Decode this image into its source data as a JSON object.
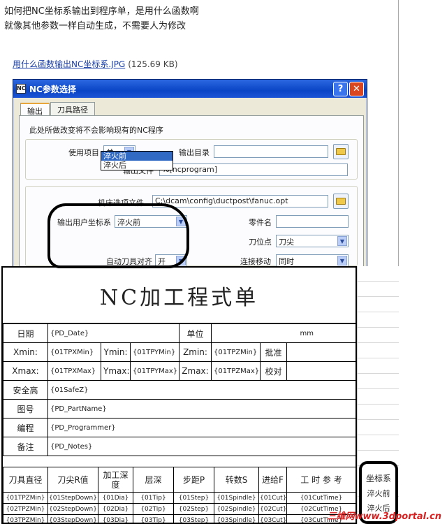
{
  "post": {
    "line1": "如何把NC坐标系输出到程序单，是用什么函数啊",
    "line2": "就像其他参数一样自动生成，不需要人为修改",
    "attachment_name": "用什么函数输出NC坐标系.JPG",
    "attachment_size": "(125.69 KB)"
  },
  "dialog": {
    "title": "NC参数选择",
    "help_btn": "?",
    "close_btn": "✕",
    "tabs": [
      "输出",
      "刀具路径"
    ],
    "note": "此处所做改变将不会影响现有的NC程序",
    "use_item_label": "使用项目",
    "use_item_value": "关",
    "output_dir_label": "输出目录",
    "output_dir_value": "",
    "output_file_label": "输出文件",
    "output_file_value": "%[ncprogram]",
    "machine_file_label": "机床选项文件",
    "machine_file_value": "C:\\dcam\\config\\ductpost\\fanuc.opt",
    "user_coord_label": "输出用户坐标系",
    "user_coord_value": "淬火前",
    "user_coord_options": [
      "淬火前",
      "淬火后"
    ],
    "part_name_label": "零件名",
    "part_name_value": "",
    "tool_point_label": "刀位点",
    "tool_point_value": "刀尖",
    "auto_align_label": "自动刀具对齐",
    "auto_align_value": "开",
    "connect_label": "连接移动",
    "connect_value": "同时"
  },
  "sheet": {
    "title": "NC加工程式单",
    "date_label": "日期",
    "date_value": "{PD_Date}",
    "unit_label": "单位",
    "unit_value": "mm",
    "xmin_label": "Xmin:",
    "xmin_value": "{01TPXMin}",
    "ymin_label": "Ymin:",
    "ymin_value": "{01TPYMin}",
    "zmin_label": "Zmin:",
    "zmin_value": "{01TPZMin}",
    "approve_label": "批准",
    "xmax_label": "Xmax:",
    "xmax_value": "{01TPXMax}",
    "ymax_label": "Ymax:",
    "ymax_value": "{01TPYMax}",
    "zmax_label": "Zmax:",
    "zmax_value": "{01TPZMax}",
    "check_label": "校对",
    "safe_label": "安全高",
    "safe_value": "{01SafeZ}",
    "drawing_label": "图号",
    "drawing_value": "{PD_PartName}",
    "prog_label": "编程",
    "prog_value": "{PD_Programmer}",
    "notes_label": "备注",
    "notes_value": "{PD_Notes}",
    "tool_headers": [
      "刀具直径",
      "刀尖R值",
      "加工深度",
      "层深",
      "步距P",
      "转数S",
      "进给F",
      "工 时 参 考"
    ],
    "tool_rows": [
      [
        "{01TPZMin}",
        "{01StepDown}",
        "{01Dia}",
        "{01Tip}",
        "{01Step}",
        "{01Spindle}",
        "{01Cut}",
        "{01CutTime}"
      ],
      [
        "{02TPZMin}",
        "{02StepDown}",
        "{02Dia}",
        "{02Tip}",
        "{02Step}",
        "{02Spindle}",
        "{02Cut}",
        "{02CutTime}"
      ],
      [
        "{03TPZMin}",
        "{03StepDown}",
        "{03Dia}",
        "{03Tip}",
        "{03Step}",
        "{03Spindle}",
        "{03Cut}",
        "{03CutTime}"
      ]
    ]
  },
  "coord": {
    "header": "坐标系",
    "items": [
      "淬火前",
      "淬火后"
    ]
  },
  "watermark": "三维网www.3dportal.cn"
}
